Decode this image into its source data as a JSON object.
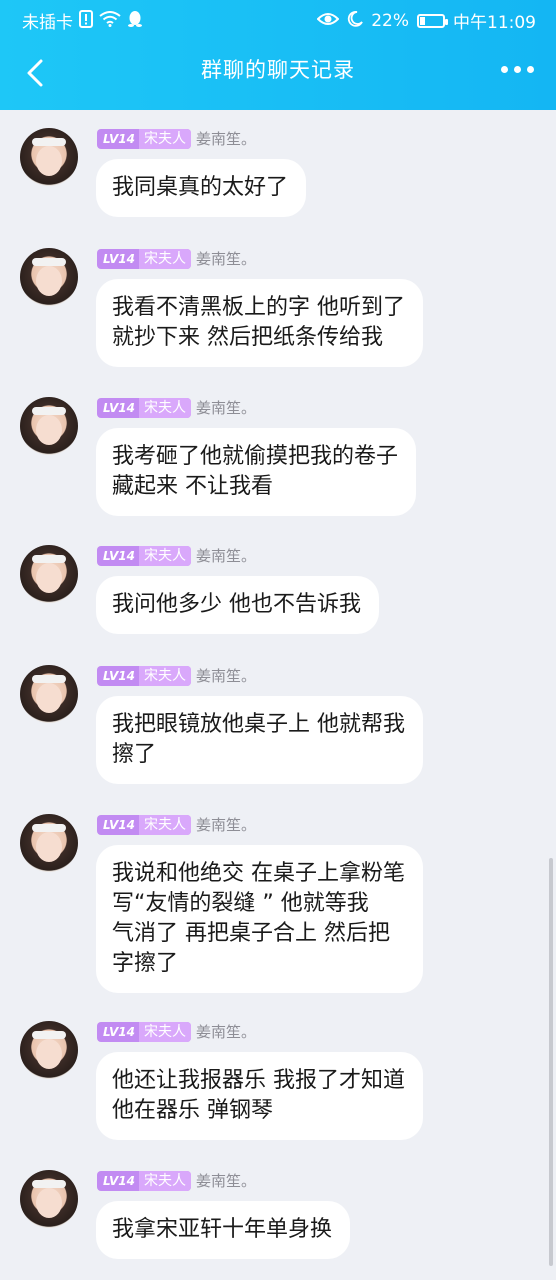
{
  "status_bar": {
    "carrier": "未插卡",
    "battery_percent": "22%",
    "battery_level": 0.22,
    "time": "中午11:09",
    "icons_left": [
      "sim-alert-icon",
      "wifi-icon",
      "qq-penguin-icon"
    ],
    "icons_right": [
      "eye-icon",
      "moon-icon",
      "battery-icon"
    ]
  },
  "header": {
    "title": "群聊的聊天记录"
  },
  "messages": [
    {
      "level": "LV14",
      "group_title": "宋夫人",
      "nickname": "姜南笙。",
      "text": "我同桌真的太好了"
    },
    {
      "level": "LV14",
      "group_title": "宋夫人",
      "nickname": "姜南笙。",
      "text": "我看不清黑板上的字 他听到了\n就抄下来 然后把纸条传给我"
    },
    {
      "level": "LV14",
      "group_title": "宋夫人",
      "nickname": "姜南笙。",
      "text": "我考砸了他就偷摸把我的卷子\n藏起来 不让我看"
    },
    {
      "level": "LV14",
      "group_title": "宋夫人",
      "nickname": "姜南笙。",
      "text": "我问他多少 他也不告诉我"
    },
    {
      "level": "LV14",
      "group_title": "宋夫人",
      "nickname": "姜南笙。",
      "text": "我把眼镜放他桌子上 他就帮我\n擦了"
    },
    {
      "level": "LV14",
      "group_title": "宋夫人",
      "nickname": "姜南笙。",
      "text": "我说和他绝交 在桌子上拿粉笔\n写“友情的裂缝 ” 他就等我\n气消了 再把桌子合上 然后把\n字擦了"
    },
    {
      "level": "LV14",
      "group_title": "宋夫人",
      "nickname": "姜南笙。",
      "text": "他还让我报器乐 我报了才知道\n他在器乐 弹钢琴"
    },
    {
      "level": "LV14",
      "group_title": "宋夫人",
      "nickname": "姜南笙。",
      "text": "我拿宋亚轩十年单身换"
    }
  ]
}
